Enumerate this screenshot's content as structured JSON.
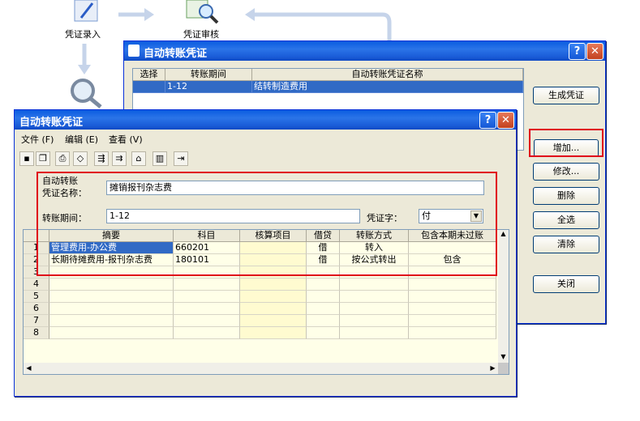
{
  "flow": {
    "voucher_entry": "凭证录入",
    "voucher_review": "凭证审核"
  },
  "back_window": {
    "title": "自动转账凭证",
    "help": "?",
    "close": "✕",
    "columns": [
      "选择",
      "转账期间",
      "自动转账凭证名称"
    ],
    "rows": [
      {
        "select": "",
        "period": "1-12",
        "name": "结转制造费用"
      }
    ],
    "buttons": {
      "generate": "生成凭证",
      "add": "增加...",
      "modify": "修改...",
      "delete": "删除",
      "select_all": "全选",
      "clear": "清除",
      "close": "关闭"
    }
  },
  "front_window": {
    "title": "自动转账凭证",
    "help": "?",
    "close": "✕",
    "menu": [
      "文件 (F)",
      "编辑 (E)",
      "查看 (V)"
    ],
    "form": {
      "name_label_line1": "自动转账",
      "name_label_line2": "凭证名称：",
      "name_value": "摊销报刊杂志费",
      "period_label": "转账期间：",
      "period_value": "1-12",
      "voucher_word_label": "凭证字：",
      "voucher_word_value": "付"
    },
    "grid": {
      "columns": [
        "",
        "摘要",
        "科目",
        "核算项目",
        "借贷",
        "转账方式",
        "包含本期未过账"
      ],
      "rows": [
        {
          "num": "1",
          "summary": "管理费用-办公费",
          "account": "660201",
          "item": "",
          "dc": "借",
          "method": "转入",
          "include": ""
        },
        {
          "num": "2",
          "summary": "长期待摊费用-报刊杂志费",
          "account": "180101",
          "item": "",
          "dc": "借",
          "method": "按公式转出",
          "include": "包含"
        },
        {
          "num": "3",
          "summary": "",
          "account": "",
          "item": "",
          "dc": "",
          "method": "",
          "include": ""
        },
        {
          "num": "4",
          "summary": "",
          "account": "",
          "item": "",
          "dc": "",
          "method": "",
          "include": ""
        },
        {
          "num": "5",
          "summary": "",
          "account": "",
          "item": "",
          "dc": "",
          "method": "",
          "include": ""
        },
        {
          "num": "6",
          "summary": "",
          "account": "",
          "item": "",
          "dc": "",
          "method": "",
          "include": ""
        },
        {
          "num": "7",
          "summary": "",
          "account": "",
          "item": "",
          "dc": "",
          "method": "",
          "include": ""
        },
        {
          "num": "8",
          "summary": "",
          "account": "",
          "item": "",
          "dc": "",
          "method": "",
          "include": ""
        }
      ]
    }
  }
}
